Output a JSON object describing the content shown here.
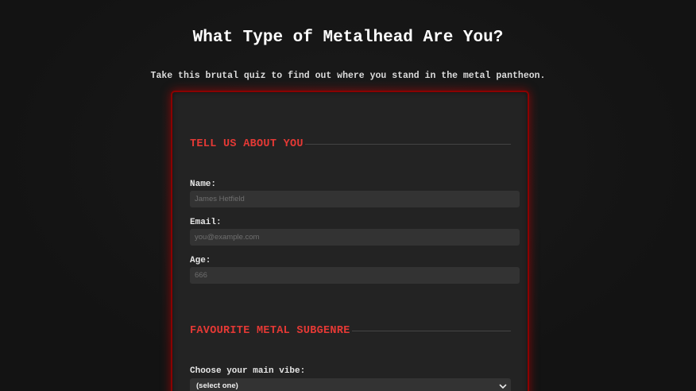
{
  "header": {
    "title": "What Type of Metalhead Are You?",
    "subtitle": "Take this brutal quiz to find out where you stand in the metal pantheon."
  },
  "sections": {
    "about": {
      "heading": "TELL US ABOUT YOU",
      "name_label": "Name:",
      "name_placeholder": "James Hetfield",
      "email_label": "Email:",
      "email_placeholder": "you@example.com",
      "age_label": "Age:",
      "age_placeholder": "666"
    },
    "subgenre": {
      "heading": "FAVOURITE METAL SUBGENRE",
      "vibe_label": "Choose your main vibe:",
      "vibe_selected": "(select one)"
    }
  },
  "colors": {
    "accent": "#e53935",
    "card_border": "#8b0000",
    "background": "#131313",
    "card": "#232323",
    "input": "#333333"
  },
  "icons": {
    "select_chevron": "chevron-down-icon"
  }
}
